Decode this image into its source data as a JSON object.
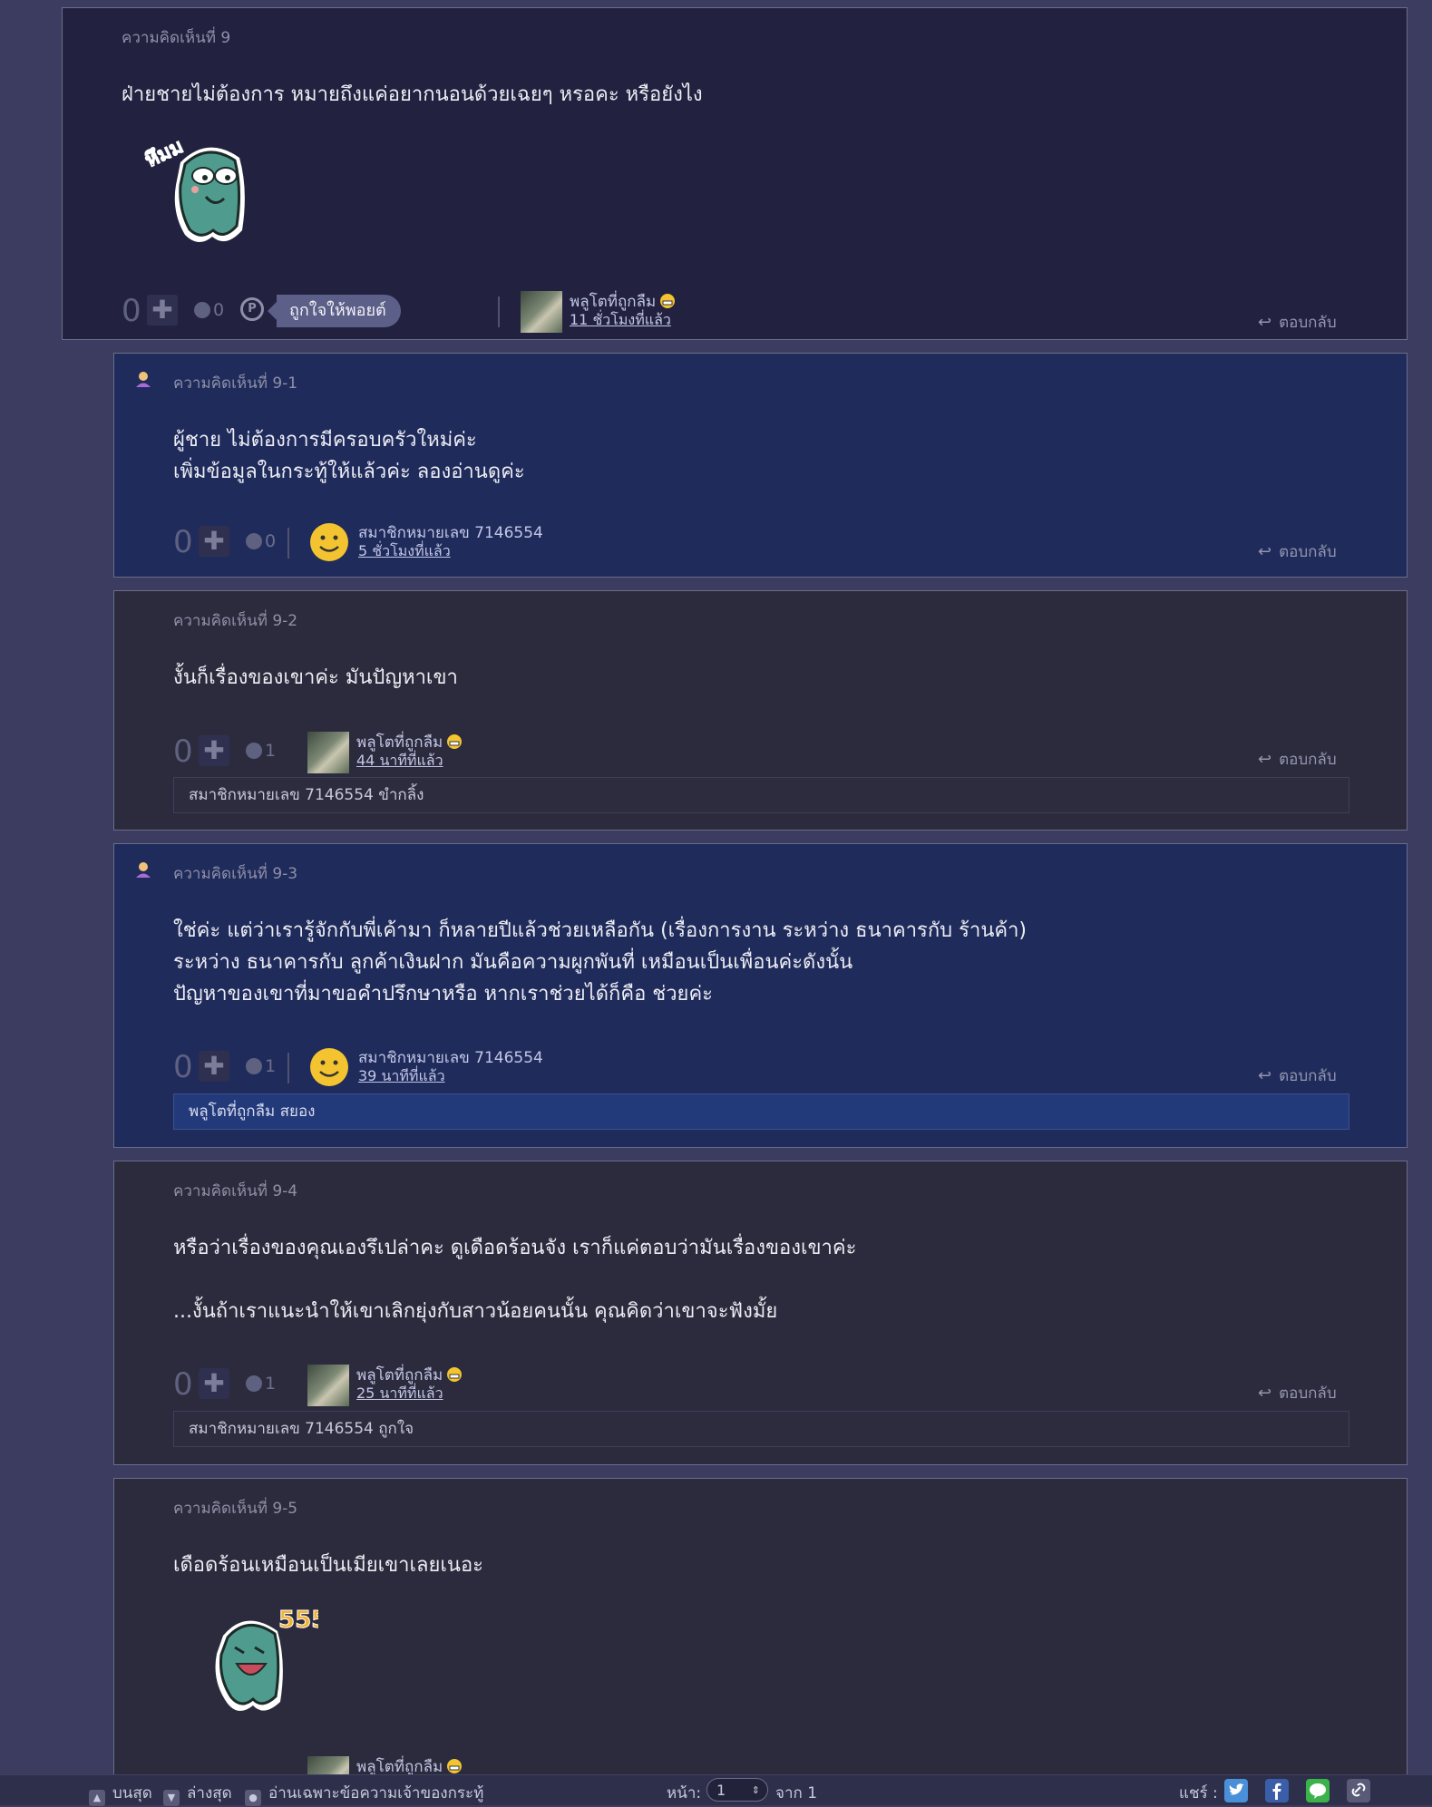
{
  "reply_label": "ตอบกลับ",
  "comments": [
    {
      "number": "ความคิดเห็นที่ 9",
      "text": "ฝ่ายชายไม่ต้องการ หมายถึงแค่อยากนอนด้วยเฉยๆ หรอคะ หรือยังไง",
      "sticker_text": "หึมม",
      "score": "0",
      "emotion_count": "0",
      "like_point_label": "ถูกใจให้พอยต์",
      "user": "พลูโตที่ถูกลืม",
      "time": "11 ชั่วโมงที่แล้ว"
    },
    {
      "number": "ความคิดเห็นที่ 9-1",
      "text": "ผู้ชาย ไม่ต้องการมีครอบครัวใหม่ค่ะ\nเพิ่มข้อมูลในกระทู้ให้แล้วค่ะ ลองอ่านดูค่ะ",
      "score": "0",
      "emotion_count": "0",
      "user": "สมาชิกหมายเลข 7146554",
      "time": "5 ชั่วโมงที่แล้ว"
    },
    {
      "number": "ความคิดเห็นที่ 9-2",
      "text": "งั้นก็เรื่องของเขาค่ะ มันปัญหาเขา",
      "score": "0",
      "emotion_count": "1",
      "user": "พลูโตที่ถูกลืม",
      "time": "44 นาทีที่แล้ว",
      "reaction": "สมาชิกหมายเลข 7146554 ขำกลิ้ง"
    },
    {
      "number": "ความคิดเห็นที่ 9-3",
      "text": "ใช่ค่ะ แต่ว่าเรารู้จักกับพี่เค้ามา ก็หลายปีแล้วช่วยเหลือกัน (เรื่องการงาน ระหว่าง ธนาคารกับ ร้านค้า)\nระหว่าง ธนาคารกับ ลูกค้าเงินฝาก มันคือความผูกพันที่ เหมือนเป็นเพื่อนค่ะดังนั้น\nปัญหาของเขาที่มาขอคำปรึกษาหรือ หากเราช่วยได้ก็คือ ช่วยค่ะ",
      "score": "0",
      "emotion_count": "1",
      "user": "สมาชิกหมายเลข 7146554",
      "time": "39 นาทีที่แล้ว",
      "reaction": "พลูโตที่ถูกลืม สยอง"
    },
    {
      "number": "ความคิดเห็นที่ 9-4",
      "text": "หรือว่าเรื่องของคุณเองรึเปล่าคะ ดูเดือดร้อนจัง เราก็แค่ตอบว่ามันเรื่องของเขาค่ะ\n\n...งั้นถ้าเราแนะนำให้เขาเลิกยุ่งกับสาวน้อยคนนั้น คุณคิดว่าเขาจะฟังมั้ย",
      "score": "0",
      "emotion_count": "1",
      "user": "พลูโตที่ถูกลืม",
      "time": "25 นาทีที่แล้ว",
      "reaction": "สมาชิกหมายเลข 7146554 ถูกใจ"
    },
    {
      "number": "ความคิดเห็นที่ 9-5",
      "text": "เดือดร้อนเหมือนเป็นเมียเขาเลยเนอะ",
      "sticker_text": "555",
      "user": "พลูโตที่ถูกลืม"
    }
  ],
  "footer": {
    "top": "บนสุด",
    "bottom": "ล่างสุด",
    "owner_only": "อ่านเฉพาะข้อความเจ้าของกระทู้",
    "page_label": "หน้า:",
    "page_value": "1",
    "of_label": "จาก 1",
    "share_label": "แชร์ :"
  },
  "colors": {
    "background": "#3b3c5f",
    "card_dark": "#222240",
    "card_blue": "#1f2b5a",
    "card_gray": "#2b2b3d",
    "twitter": "#4a90d9",
    "facebook": "#3b5ea8",
    "line": "#3cb34a"
  }
}
